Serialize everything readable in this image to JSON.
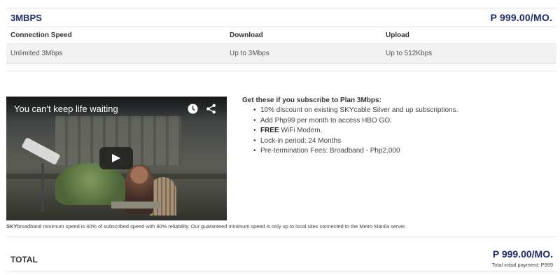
{
  "plan": {
    "name": "3MBPS",
    "price": "P 999.00/MO."
  },
  "specs": {
    "headers": [
      "Connection Speed",
      "Download",
      "Upload"
    ],
    "values": [
      "Unlimited 3Mbps",
      "Up to 3Mbps",
      "Up to 512Kbps"
    ]
  },
  "video": {
    "title": "You can't keep life waiting",
    "icons": [
      "clock-icon",
      "share-icon",
      "play-icon"
    ]
  },
  "perks": {
    "title": "Get these if you subscribe to Plan 3Mbps:",
    "items": [
      {
        "bold": "",
        "text": "10% discount on existing SKYcable Silver and up subscriptions."
      },
      {
        "bold": "",
        "text": "Add Php99 per month to access HBO GO."
      },
      {
        "bold": "FREE",
        "text": " WiFi Modem."
      },
      {
        "bold": "",
        "text": "Lock-in period: 24 Months"
      },
      {
        "bold": "",
        "text": "Pre-termination Fees: Broadband - Php2,000"
      }
    ]
  },
  "note": {
    "brand": "SKY",
    "text": "broadband minimum speed is 40% of subscribed speed with 80% reliability. Our guaranteed minimum speed is only up to local sites connected to the Metro Manila server."
  },
  "total": {
    "label": "TOTAL",
    "price": "P 999.00/MO.",
    "initial": "Total initial payment: P999"
  },
  "colors": {
    "accent": "#1d2d6b",
    "row_bg": "#f2f2f2"
  }
}
